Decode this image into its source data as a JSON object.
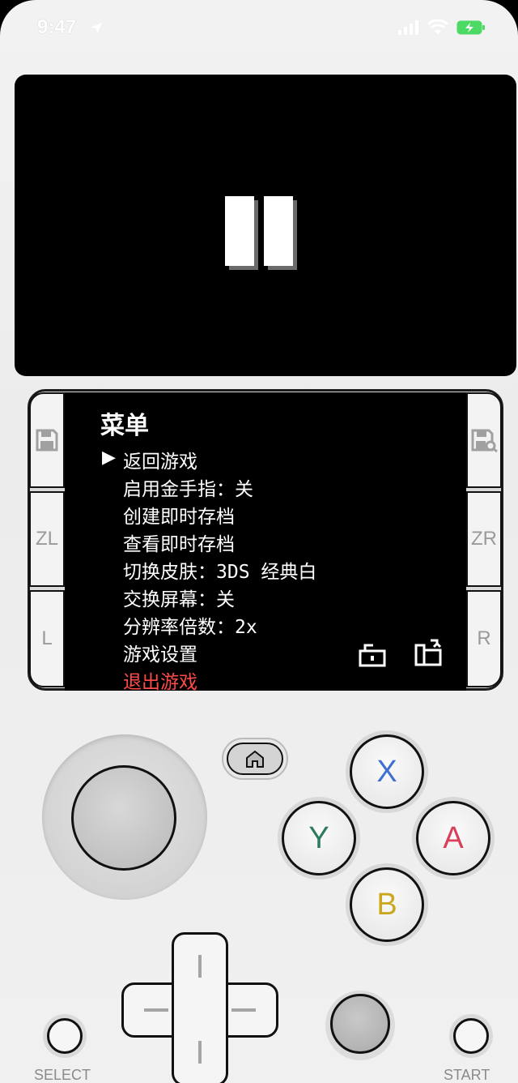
{
  "status_bar": {
    "time": "9:47",
    "icons": [
      "location-arrow-icon",
      "signal-icon",
      "wifi-icon",
      "battery-charging-icon"
    ]
  },
  "top_screen": {
    "state_icon": "pause-icon"
  },
  "side_buttons": {
    "left": [
      {
        "name": "save-icon",
        "label": ""
      },
      {
        "name": "zl",
        "label": "ZL"
      },
      {
        "name": "l",
        "label": "L"
      }
    ],
    "right": [
      {
        "name": "load-save-icon",
        "label": ""
      },
      {
        "name": "zr",
        "label": "ZR"
      },
      {
        "name": "r",
        "label": "R"
      }
    ]
  },
  "menu": {
    "title": "菜单",
    "cursor": "▶",
    "items": [
      "返回游戏",
      "启用金手指：关",
      "创建即时存档",
      "查看即时存档",
      "切换皮肤：3DS 经典白",
      "交换屏幕：关",
      "分辨率倍数：2x",
      "游戏设置",
      "退出游戏"
    ],
    "icons": [
      "unlock-icon",
      "rotate-screen-icon"
    ],
    "exit_color": "#ff4a4a"
  },
  "controls": {
    "face_buttons": {
      "x": {
        "label": "X",
        "color": "#3f6fd0"
      },
      "y": {
        "label": "Y",
        "color": "#2e7a5c"
      },
      "a": {
        "label": "A",
        "color": "#d8405a"
      },
      "b": {
        "label": "B",
        "color": "#c9a81f"
      }
    },
    "select_label": "SELECT",
    "start_label": "START",
    "home_icon": "home-icon"
  }
}
